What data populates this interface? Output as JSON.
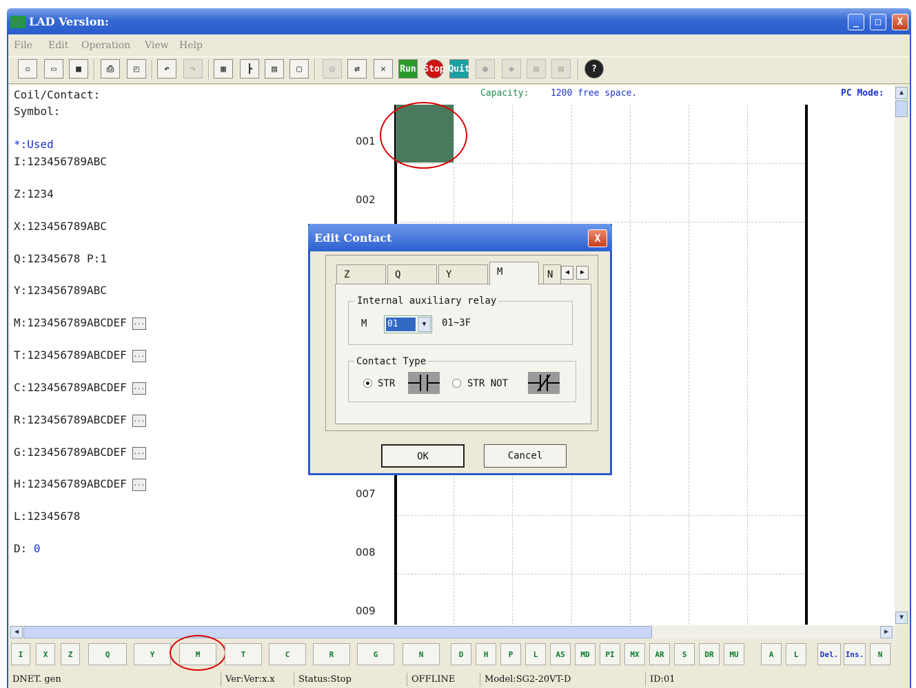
{
  "window": {
    "title": "LAD Version:",
    "min": "_",
    "max": "□",
    "close": "X"
  },
  "menu": [
    "File",
    "Edit",
    "Operation",
    "View",
    "Help"
  ],
  "toolbar_labels": {
    "run": "Run",
    "stop": "Stop",
    "quit": "Quit",
    "help": "?"
  },
  "header": {
    "coil_contact": "Coil/Contact:",
    "symbol": "Symbol:",
    "capacity_label": "Capacity:",
    "capacity_value": "1200 free space.",
    "pc_mode": "PC Mode:"
  },
  "symbols": {
    "used": "*:Used",
    "I": "I:123456789ABC",
    "Z": "Z:1234",
    "X": "X:123456789ABC",
    "Q": "Q:12345678  P:1",
    "Y": "Y:123456789ABC",
    "M": "M:123456789ABCDEF",
    "T": "T:123456789ABCDEF",
    "C": "C:123456789ABCDEF",
    "R": "R:123456789ABCDEF",
    "G": "G:123456789ABCDEF",
    "H": "H:123456789ABCDEF",
    "L": "L:12345678",
    "D_label": "D:",
    "D_value": "0",
    "more": "..."
  },
  "rows": [
    "001",
    "002",
    "007",
    "008",
    "009"
  ],
  "dialog": {
    "title": "Edit Contact",
    "close": "X",
    "tabs": [
      "Z",
      "Q",
      "Y",
      "M",
      "N"
    ],
    "active_tab": "M",
    "group1_title": "Internal auxiliary relay",
    "field_label": "M",
    "field_value": "01",
    "field_range": "01~3F",
    "group2_title": "Contact Type",
    "opt1": "STR",
    "opt2": "STR NOT",
    "selected": "STR",
    "ok": "OK",
    "cancel": "Cancel"
  },
  "bottom_toolbar": [
    "I",
    "X",
    "Z",
    "Q",
    "Y",
    "M",
    "T",
    "C",
    "R",
    "G",
    "N",
    "D",
    "H",
    "P",
    "L",
    "AS",
    "MD",
    "PI",
    "MX",
    "AR",
    "S",
    "DR",
    "MU",
    "A",
    "L",
    "Del.",
    "Ins.",
    "N"
  ],
  "status": {
    "file": "DNET. gen",
    "ver": "Ver:Ver:x.x",
    "state": "Status:Stop",
    "conn": "OFFLINE",
    "model": "Model:SG2-20VT-D",
    "id": "ID:01"
  },
  "colors": {
    "title_bar": "#2a5bcc",
    "selected_cell": "#4a7a5e",
    "highlight_circle": "#dd0000",
    "symbol_blue": "#1a33cc"
  }
}
